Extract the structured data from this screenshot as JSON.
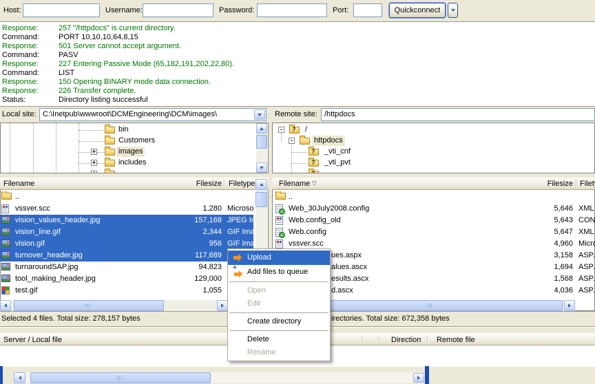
{
  "toolbar": {
    "host_label": "Host:",
    "host_value": "",
    "username_label": "Username:",
    "username_value": "",
    "password_label": "Password:",
    "password_value": "",
    "port_label": "Port:",
    "port_value": "",
    "quickconnect_label": "Quickconnect"
  },
  "log": {
    "response_color": "#007800",
    "lines": [
      {
        "label": "Response:",
        "text": "257 \"/httpdocs\" is current directory.",
        "kind": "response"
      },
      {
        "label": "Command:",
        "text": "PORT 10,10,10,64,8,15",
        "kind": "command"
      },
      {
        "label": "Response:",
        "text": "501 Server cannot accept argument.",
        "kind": "response"
      },
      {
        "label": "Command:",
        "text": "PASV",
        "kind": "command"
      },
      {
        "label": "Response:",
        "text": "227 Entering Passive Mode (65,182,191,202,22,80).",
        "kind": "response"
      },
      {
        "label": "Command:",
        "text": "LIST",
        "kind": "command"
      },
      {
        "label": "Response:",
        "text": "150 Opening BINARY mode data connection.",
        "kind": "response"
      },
      {
        "label": "Response:",
        "text": "226 Transfer complete.",
        "kind": "response"
      },
      {
        "label": "Status:",
        "text": "Directory listing successful",
        "kind": "status"
      }
    ]
  },
  "local_site": {
    "label": "Local site:",
    "value": "C:\\Inetpub\\wwwroot\\DCMEngineering\\DCM\\images\\",
    "tree": [
      {
        "label": "bin",
        "expand": "",
        "icon": "folder"
      },
      {
        "label": "Customers",
        "expand": "",
        "icon": "folder"
      },
      {
        "label": "images",
        "expand": "+",
        "icon": "folder",
        "selected": true
      },
      {
        "label": "includes",
        "expand": "+",
        "icon": "folder"
      },
      {
        "label": "",
        "expand": "+",
        "icon": "folder",
        "partial": true
      }
    ],
    "columns": [
      "Filename",
      "Filesize",
      "Filetype"
    ],
    "files": [
      {
        "name": "..",
        "icon": "folder",
        "size": "",
        "type": ""
      },
      {
        "name": "vssver.scc",
        "icon": "scc",
        "size": "1,280",
        "type": "Microso"
      },
      {
        "name": "vision_values_header.jpg",
        "icon": "img",
        "size": "157,168",
        "type": "JPEG Im",
        "selected": true
      },
      {
        "name": "vision_line.gif",
        "icon": "img",
        "size": "2,344",
        "type": "GIF Ima",
        "selected": true
      },
      {
        "name": "vision.gif",
        "icon": "img",
        "size": "956",
        "type": "GIF Ima",
        "selected": true
      },
      {
        "name": "turnover_header.jpg",
        "icon": "img",
        "size": "117,689",
        "type": "",
        "selected": true
      },
      {
        "name": "turnaroundSAP.jpg",
        "icon": "img",
        "size": "94,823",
        "type": ""
      },
      {
        "name": "tool_making_header.jpg",
        "icon": "img",
        "size": "129,000",
        "type": ""
      },
      {
        "name": "test.gif",
        "icon": "test",
        "size": "1,055",
        "type": ""
      }
    ],
    "status": "Selected 4 files. Total size: 278,157 bytes"
  },
  "remote_site": {
    "label": "Remote site:",
    "value": "/httpdocs",
    "tree": [
      {
        "label": "/",
        "expand": "-",
        "icon": "qfolder"
      },
      {
        "label": "httpdocs",
        "expand": "-",
        "icon": "folder",
        "selected": true
      },
      {
        "label": "_vti_cnf",
        "expand": "",
        "icon": "qfolder"
      },
      {
        "label": "_vti_pvt",
        "expand": "",
        "icon": "qfolder"
      },
      {
        "label": "",
        "expand": "",
        "icon": "qfolder",
        "partial": true
      }
    ],
    "columns": [
      "Filename",
      "Filesize",
      "Filetype"
    ],
    "sort_indicator": "▽",
    "files": [
      {
        "name": "..",
        "icon": "folder",
        "size": "",
        "type": ""
      },
      {
        "name": "Web_30July2008.config",
        "icon": "xml",
        "size": "5,646",
        "type": "XML C"
      },
      {
        "name": "Web.config_old",
        "icon": "scc",
        "size": "5,643",
        "type": "CONF"
      },
      {
        "name": "Web.config",
        "icon": "xml",
        "size": "5,647",
        "type": "XML C"
      },
      {
        "name": "vssver.scc",
        "icon": "scc",
        "size": "4,960",
        "type": "Micro"
      },
      {
        "name": "ues.aspx",
        "icon": "",
        "size": "3,158",
        "type": "ASP.N",
        "fragment": true
      },
      {
        "name": "alues.ascx",
        "icon": "",
        "size": "1,694",
        "type": "ASP.N",
        "fragment": true
      },
      {
        "name": "esults.ascx",
        "icon": "",
        "size": "1,568",
        "type": "ASP.N",
        "fragment": true
      },
      {
        "name": "d.ascx",
        "icon": "",
        "size": "4,036",
        "type": "ASP.N",
        "fragment": true
      }
    ],
    "status": "irectories. Total size: 672,358 bytes"
  },
  "context_menu": {
    "items": [
      {
        "label": "Upload",
        "icon": "upload-icon",
        "highlighted": true
      },
      {
        "label": "Add files to queue",
        "icon": "add-queue-icon"
      },
      {
        "separator": true
      },
      {
        "label": "Open",
        "disabled": true
      },
      {
        "label": "Edit",
        "disabled": true
      },
      {
        "separator": true
      },
      {
        "label": "Create directory"
      },
      {
        "separator": true
      },
      {
        "label": "Delete"
      },
      {
        "label": "Rename",
        "disabled": true
      }
    ]
  },
  "queue": {
    "columns": [
      "Server / Local file",
      "Direction",
      "Remote file"
    ]
  }
}
